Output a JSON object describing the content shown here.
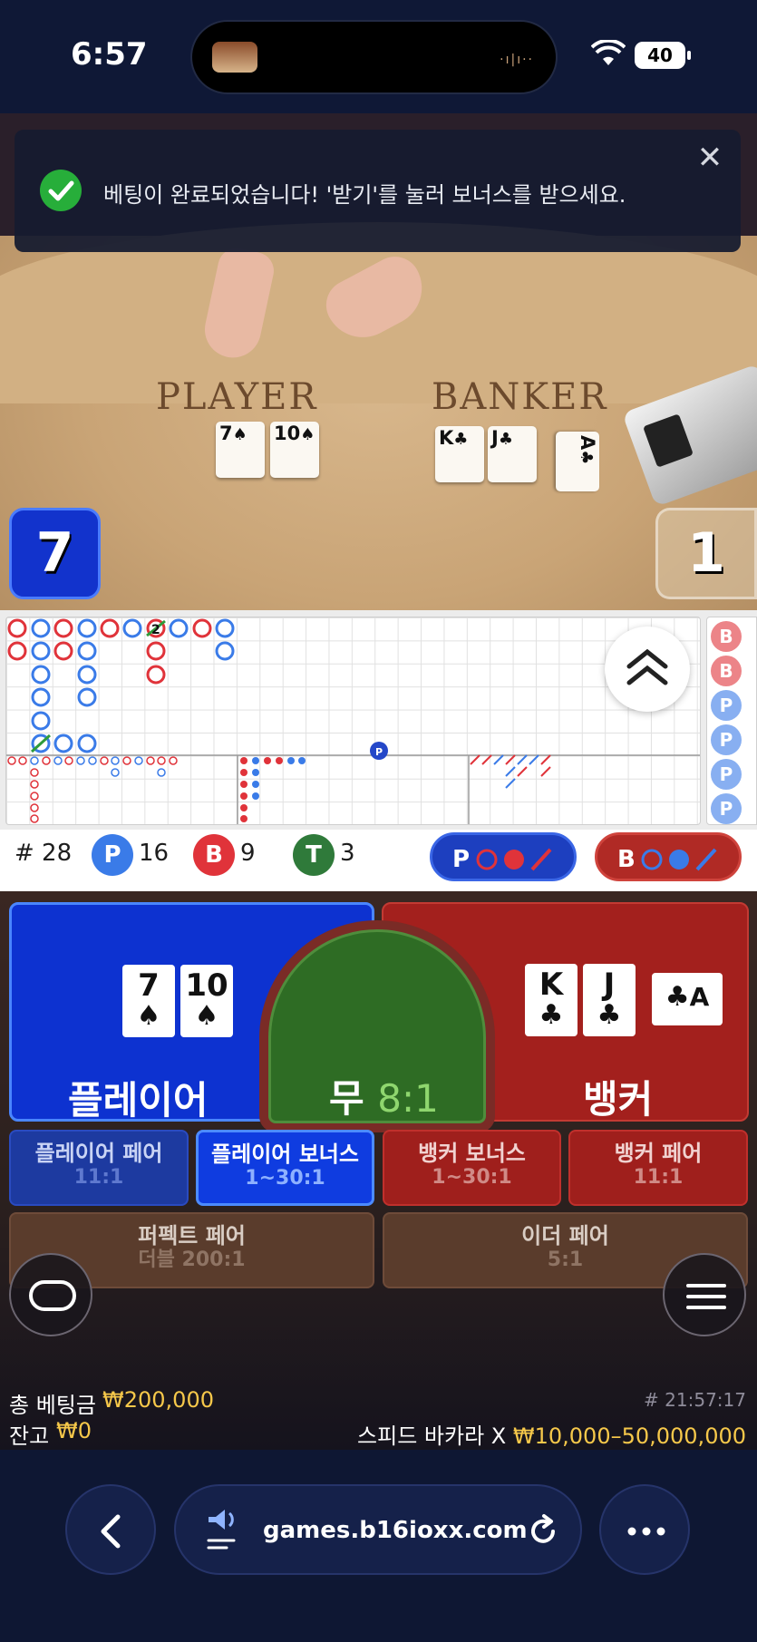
{
  "status": {
    "time": "6:57",
    "battery": "40"
  },
  "toast": {
    "message": "베팅이 완료되었습니다! '받기'를 눌러 보너스를 받으세요."
  },
  "table": {
    "player_title": "PLAYER",
    "banker_title": "BANKER",
    "player_cards": [
      {
        "rank": "7",
        "suit": "♠"
      },
      {
        "rank": "10",
        "suit": "♠"
      }
    ],
    "banker_cards": [
      {
        "rank": "K",
        "suit": "♣"
      },
      {
        "rank": "J",
        "suit": "♣"
      },
      {
        "rank": "A",
        "suit": "♣"
      }
    ],
    "player_score": "7",
    "banker_score": "1"
  },
  "roadmap": {
    "side_road": [
      "B",
      "B",
      "P",
      "P",
      "P",
      "P"
    ],
    "big_road_marker": "2",
    "bead_marker": "P"
  },
  "stats": {
    "rounds": "# 28",
    "player_letter": "P",
    "player_wins": "16",
    "banker_letter": "B",
    "banker_wins": "9",
    "tie_letter": "T",
    "ties": "3",
    "player_ask": "P",
    "banker_ask": "B"
  },
  "bets": {
    "player_label": "플레이어",
    "tie_label": "무",
    "tie_odds": "8:1",
    "banker_label": "뱅커",
    "side": [
      {
        "name": "플레이어 페어",
        "odds": "11:1"
      },
      {
        "name": "플레이어 보너스",
        "odds": "1~30:1"
      },
      {
        "name": "뱅커 보너스",
        "odds": "1~30:1"
      },
      {
        "name": "뱅커 페어",
        "odds": "11:1"
      }
    ],
    "perfect_pair": {
      "name": "퍼펙트 페어",
      "odds": "더블 200:1"
    },
    "either_pair": {
      "name": "이더 페어",
      "odds": "5:1"
    }
  },
  "footer": {
    "total_bet_label": "총 베팅금",
    "total_bet": "₩200,000",
    "balance_label": "잔고",
    "balance": "₩0",
    "round_id": "# 21:57:17",
    "table_name": "스피드 바카라 X",
    "table_limits": "₩10,000–50,000,000"
  },
  "browser": {
    "url": "games.b16ioxx.com"
  },
  "colors": {
    "player": "#0d32d0",
    "banker": "#a3201d",
    "tie": "#2e6c24",
    "gold": "#f6c84a"
  }
}
